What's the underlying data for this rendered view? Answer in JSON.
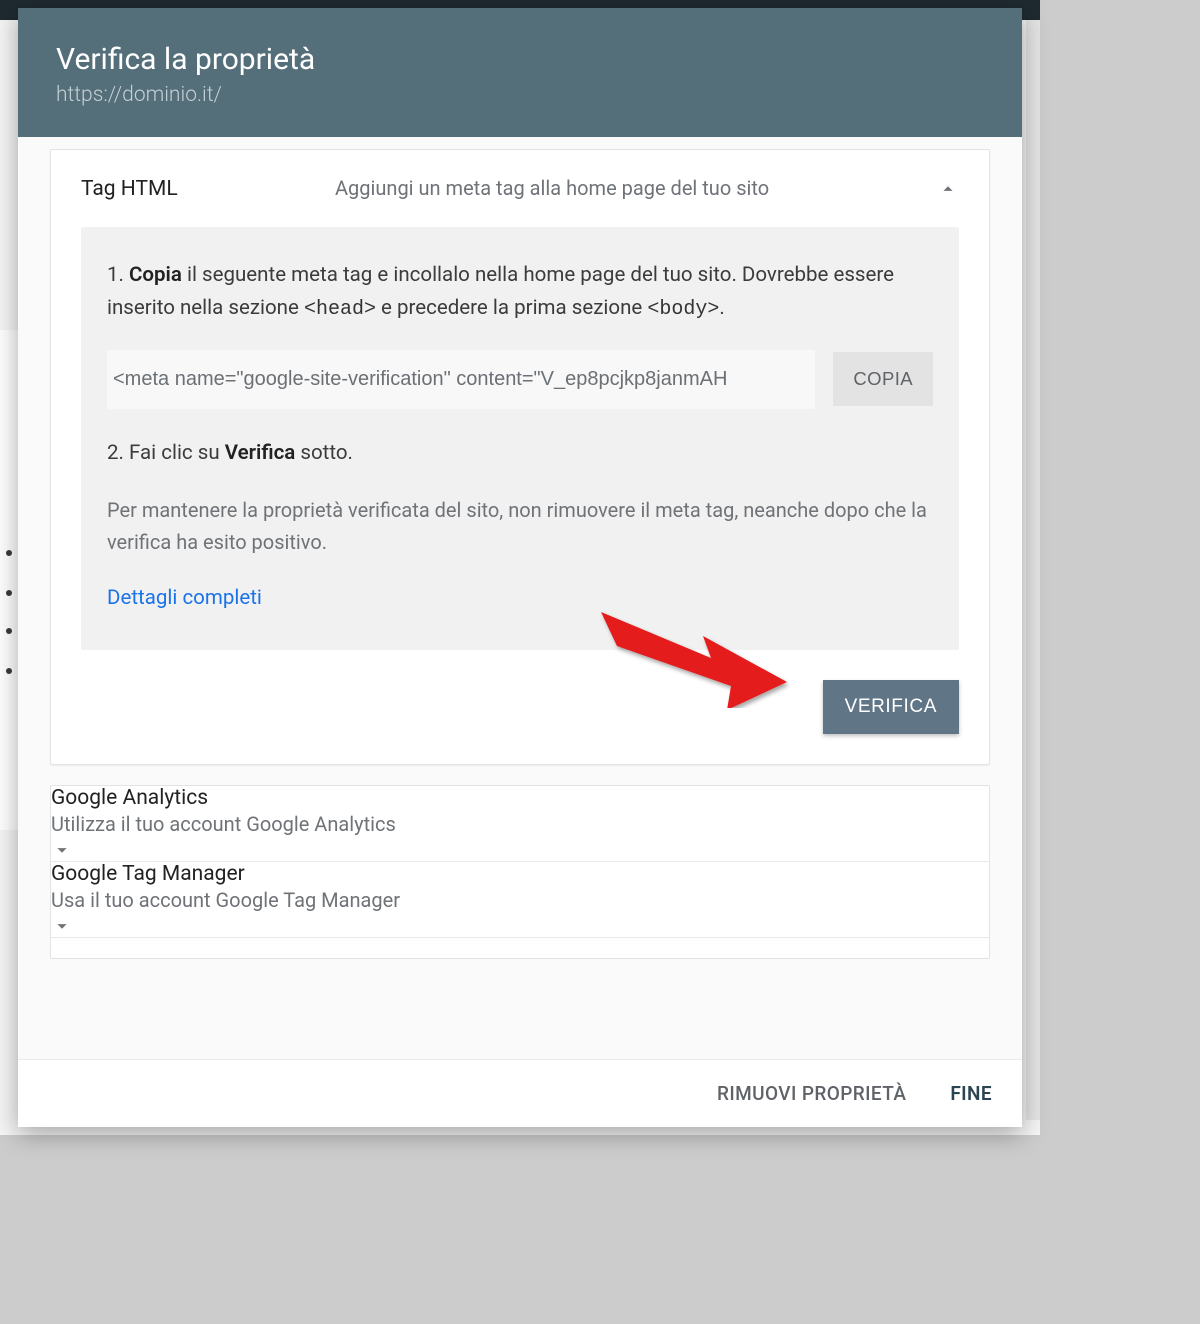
{
  "header": {
    "title": "Verifica la proprietà",
    "url": "https://dominio.it/"
  },
  "method_html": {
    "name": "Tag HTML",
    "desc": "Aggiungi un meta tag alla home page del tuo sito",
    "step1_pre": "1. ",
    "step1_bold": "Copia",
    "step1_mid": " il seguente meta tag e incollalo nella home page del tuo sito. Dovrebbe essere inserito nella sezione ",
    "step1_code1": "<head>",
    "step1_mid2": " e precedere la prima sezione ",
    "step1_code2": "<body>",
    "step1_end": ".",
    "meta_tag": "<meta name=\"google-site-verification\" content=\"V_ep8pcjkp8janmAH",
    "copy_label": "COPIA",
    "step2_pre": "2. Fai clic su ",
    "step2_bold": "Verifica",
    "step2_end": " sotto.",
    "note": "Per mantenere la proprietà verificata del sito, non rimuovere il meta tag, neanche dopo che la verifica ha esito positivo.",
    "details_link": "Dettagli completi",
    "verify_label": "VERIFICA"
  },
  "method_ga": {
    "name": "Google Analytics",
    "desc": "Utilizza il tuo account Google Analytics"
  },
  "method_gtm": {
    "name": "Google Tag Manager",
    "desc": "Usa il tuo account Google Tag Manager"
  },
  "footer": {
    "remove": "RIMUOVI PROPRIETÀ",
    "done": "FINE"
  }
}
